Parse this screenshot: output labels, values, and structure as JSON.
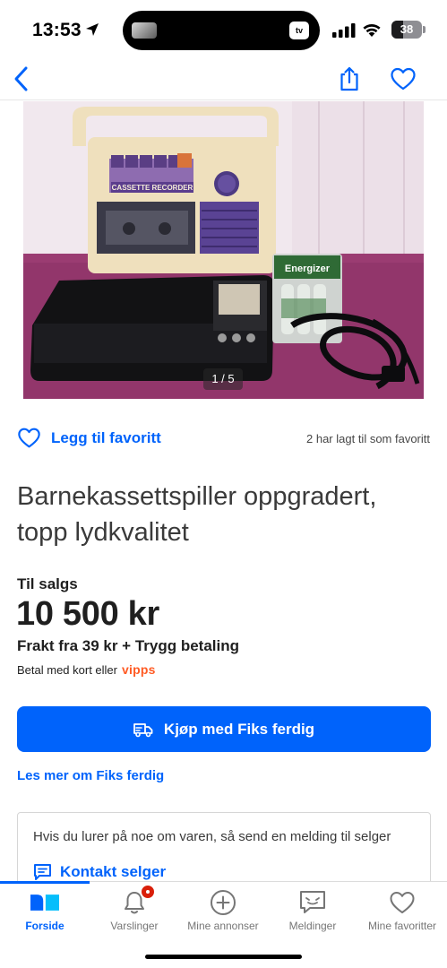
{
  "status_bar": {
    "time": "13:53",
    "tv_label": "tv",
    "battery": 38,
    "battery_label": "38"
  },
  "nav": {
    "back_icon": "chevron-left-icon",
    "share_icon": "share-icon",
    "favorite_icon": "heart-icon"
  },
  "gallery": {
    "counter": "1 / 5",
    "cassette_label": "CASSETTE RECORDER",
    "battery_brand": "Energizer"
  },
  "favorite": {
    "label": "Legg til favoritt",
    "count_text": "2 har lagt til som favoritt"
  },
  "listing": {
    "title": "Barnekassettspiller oppgradert, topp lydkvalitet",
    "status": "Til salgs",
    "price": "10 500 kr",
    "shipping": "Frakt fra 39 kr + Trygg betaling",
    "payment_text": "Betal med kort eller",
    "vipps_logo": "vipps"
  },
  "buy_button": {
    "label": "Kjøp med Fiks ferdig",
    "icon": "delivery-truck-icon"
  },
  "read_more": {
    "label": "Les mer om Fiks ferdig"
  },
  "contact": {
    "text": "Hvis du lurer på noe om varen, så send en melding til selger",
    "link_label": "Kontakt selger",
    "icon": "chat-icon"
  },
  "tabs": [
    {
      "label": "Forside",
      "icon": "home-icon",
      "active": true
    },
    {
      "label": "Varslinger",
      "icon": "bell-icon",
      "active": false,
      "badge": true
    },
    {
      "label": "Mine annonser",
      "icon": "plus-circle-icon",
      "active": false
    },
    {
      "label": "Meldinger",
      "icon": "messages-icon",
      "active": false
    },
    {
      "label": "Mine favoritter",
      "icon": "heart-icon",
      "active": false
    }
  ],
  "colors": {
    "accent": "#0063fb",
    "vipps": "#ff5b24",
    "badge": "#d91f0a",
    "text": "#1f1f1f"
  }
}
